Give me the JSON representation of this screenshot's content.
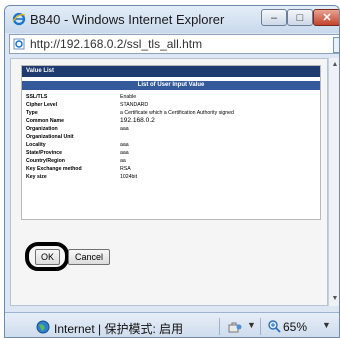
{
  "window": {
    "title": "B840 - Windows Internet Explorer",
    "minimize_label": "–",
    "maximize_label": "□",
    "close_label": "✕"
  },
  "addressbar": {
    "url": "http://192.168.0.2/ssl_tls_all.htm"
  },
  "panel": {
    "title": "Value List",
    "list_header": "List of User Input Value",
    "rows": [
      {
        "key": "SSL/TLS",
        "value": "Enable"
      },
      {
        "key": "Cipher Level",
        "value": "STANDARD"
      },
      {
        "key": "Type",
        "value": "a Certificate which a Certification Authority signed"
      },
      {
        "key": "Common Name",
        "value": "192.168.0.2"
      },
      {
        "key": "Organization",
        "value": "aaa"
      },
      {
        "key": "Organizational Unit",
        "value": ""
      },
      {
        "key": "Locality",
        "value": "aaa"
      },
      {
        "key": "State/Province",
        "value": "aaa"
      },
      {
        "key": "Country/Region",
        "value": "aa"
      },
      {
        "key": "Key Exchange method",
        "value": "RSA"
      },
      {
        "key": "Key size",
        "value": "1024bit"
      }
    ]
  },
  "buttons": {
    "ok_label": "OK",
    "cancel_label": "Cancel"
  },
  "statusbar": {
    "zone_text": "Internet | 保护模式: 启用",
    "zoom_text": "65%"
  },
  "icons": {
    "window": "internet-explorer-icon",
    "page": "page-icon",
    "status": "globe-icon",
    "zone": "security-zone-icon",
    "zoom": "zoom-icon"
  },
  "colors": {
    "panel_header": "#1f3a6e",
    "list_header": "#345a9c"
  }
}
